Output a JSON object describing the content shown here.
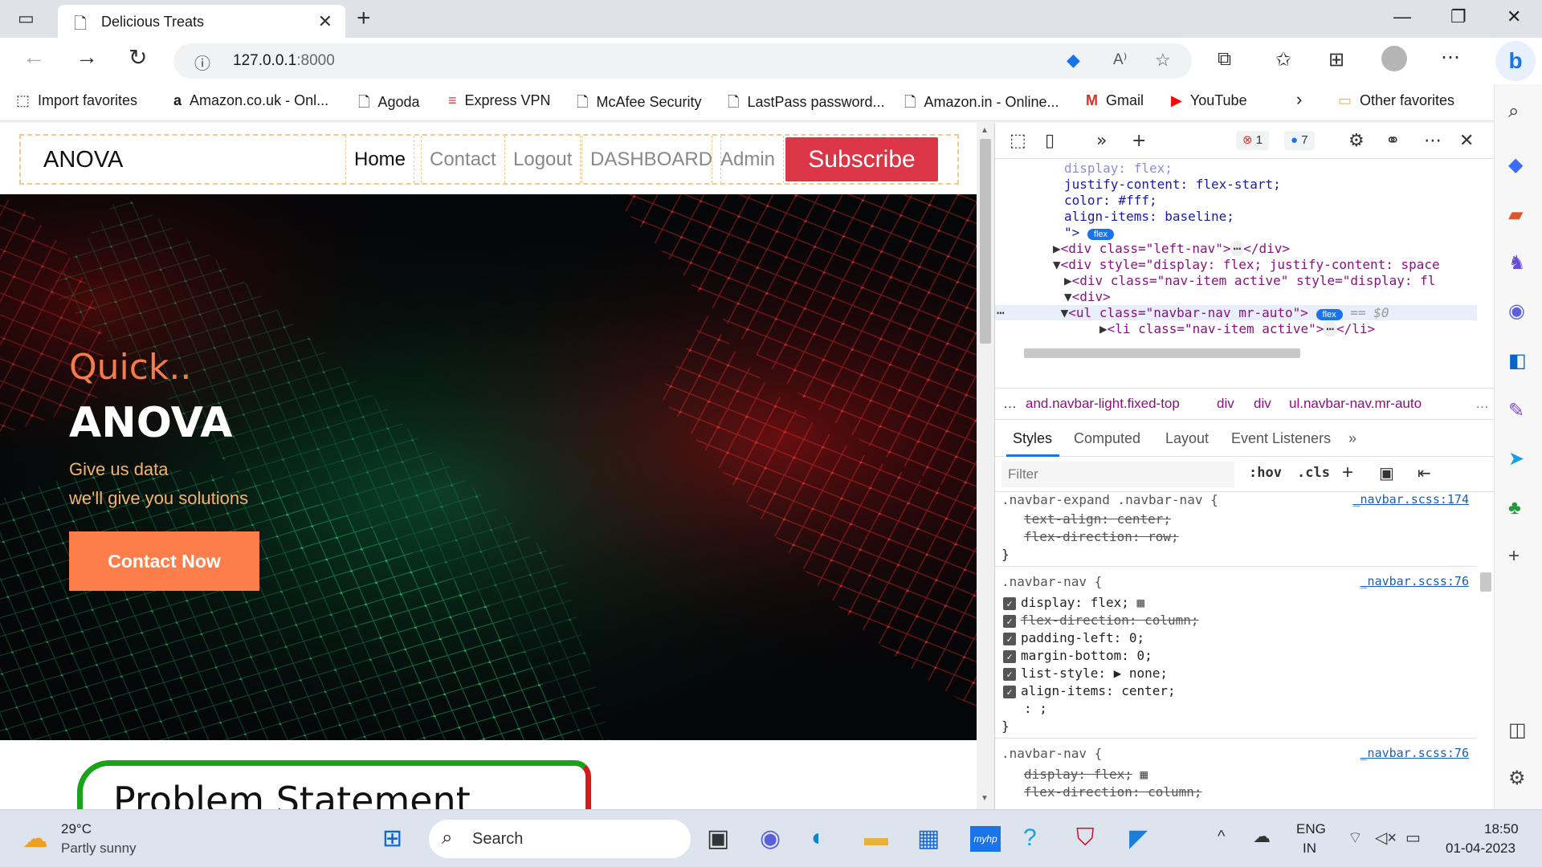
{
  "browser": {
    "tab_title": "Delicious Treats",
    "tab_close": "✕",
    "new_tab": "+",
    "url_host": "127.0.0.1",
    "url_port": ":8000"
  },
  "favorites": [
    {
      "label": "Import favorites",
      "icon": "import-icon"
    },
    {
      "label": "Amazon.co.uk - Onl...",
      "icon": "amazon-icon"
    },
    {
      "label": "Agoda",
      "icon": "page-icon"
    },
    {
      "label": "Express VPN",
      "icon": "expressvpn-icon"
    },
    {
      "label": "McAfee Security",
      "icon": "page-icon"
    },
    {
      "label": "LastPass password...",
      "icon": "page-icon"
    },
    {
      "label": "Amazon.in - Online...",
      "icon": "page-icon"
    },
    {
      "label": "Gmail",
      "icon": "gmail-icon"
    },
    {
      "label": "YouTube",
      "icon": "youtube-icon"
    },
    {
      "label": "Other favorites",
      "icon": "folder-icon"
    }
  ],
  "site": {
    "brand": "ANOVA",
    "nav": [
      "Home",
      "Contact",
      "Logout",
      "DASHBOARD",
      "Admin"
    ],
    "subscribe": "Subscribe",
    "hero": {
      "kicker": "Quick..",
      "title": "ANOVA",
      "line1": "Give us data",
      "line2": "we'll give you solutions",
      "cta": "Contact Now"
    },
    "section_title": "Problem Statement"
  },
  "devtools": {
    "error_count": "1",
    "message_count": "7",
    "dom_lines": [
      "display: flex;",
      "justify-content: flex-start;",
      "color: #fff;",
      "align-items: baseline;",
      "\">",
      "flex"
    ],
    "dom_div_left_nav": "<div class=\"left-nav\">",
    "dom_div_style": "<div style=\"display: flex; justify-content: space",
    "dom_div_nav_item": "<div class=\"nav-item active\" style=\"display: fl",
    "dom_div": "<div>",
    "dom_ul": "<ul class=\"navbar-nav mr-auto\">",
    "dom_li": "<li class=\"nav-item active\">",
    "dom_close_div": "</div>",
    "dom_close_li": "</li>",
    "dom_eq": "== $0",
    "crumbs": [
      "and.navbar-light.fixed-top",
      "div",
      "div",
      "ul.navbar-nav.mr-auto"
    ],
    "subtabs": [
      "Styles",
      "Computed",
      "Layout",
      "Event Listeners"
    ],
    "filter_placeholder": "Filter",
    "hov": ":hov",
    "cls": ".cls",
    "rule1_selector": ".navbar-expand .navbar-nav {",
    "rule1_source": "_navbar.scss:174",
    "rule1_props": [
      "text-align: center;",
      "flex-direction: row;"
    ],
    "rule2_selector": ".navbar-nav {",
    "rule2_source": "_navbar.scss:76",
    "rule2_props": [
      "display: flex;",
      "flex-direction: column;",
      "padding-left: 0;",
      "margin-bottom: 0;",
      "list-style: ▶ none;",
      "align-items: center;",
      ": ;"
    ],
    "rule3_selector": ".navbar-nav {",
    "rule3_source": "_navbar.scss:76",
    "rule3_props": [
      "display: flex;",
      "flex-direction: column;"
    ],
    "close_brace": "}"
  },
  "taskbar": {
    "temp": "29°C",
    "weather": "Partly sunny",
    "search": "Search",
    "lang1": "ENG",
    "lang2": "IN",
    "time": "18:50",
    "date": "01-04-2023"
  },
  "colors": {
    "subscribe": "#dc3545",
    "cta": "#fd7e4a",
    "kicker": "#f47c4a",
    "devtools_accent": "#1a73e8"
  }
}
